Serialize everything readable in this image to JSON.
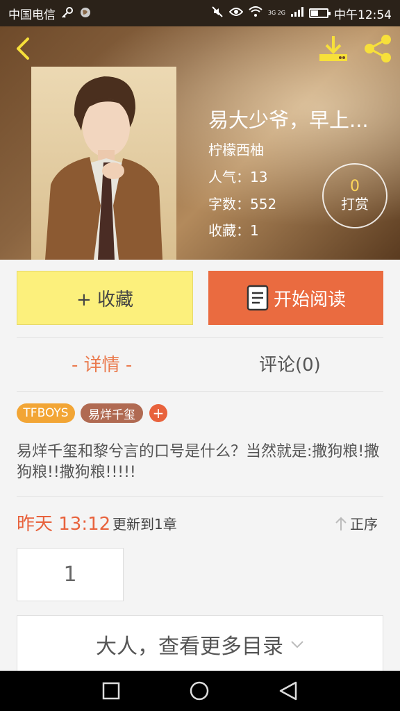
{
  "status_bar": {
    "carrier": "中国电信",
    "time": "中午12:54",
    "network": "3G 2G",
    "battery_percent": 45
  },
  "header": {
    "icons": [
      "back-icon",
      "download-icon",
      "share-icon"
    ]
  },
  "book": {
    "title": "易大少爷，早上...",
    "author": "柠檬西柚",
    "popularity": "人气：13",
    "word_count": "字数：552",
    "favorites": "收藏：1",
    "reward_count": "0",
    "reward_label": "打赏"
  },
  "actions": {
    "favorite_label": "+ 收藏",
    "read_label": "开始阅读"
  },
  "tabs": {
    "detail": "- 详情 -",
    "comments": "评论(0)"
  },
  "tags": [
    "TFBOYS",
    "易烊千玺",
    "+"
  ],
  "description": "易烊千玺和黎兮言的口号是什么？当然就是:撒狗粮!撒狗粮!!撒狗粮!!!!!",
  "update": {
    "time": "昨天 13:12",
    "info": "更新到1章",
    "sort_label": "正序"
  },
  "chapters": [
    "1"
  ],
  "more_catalog": "大人，查看更多目录",
  "colors": {
    "accent": "#ea6b40",
    "favorite_button": "#fcf07c",
    "tag_orange": "#f2a535",
    "tag_brown": "#b06a52"
  }
}
